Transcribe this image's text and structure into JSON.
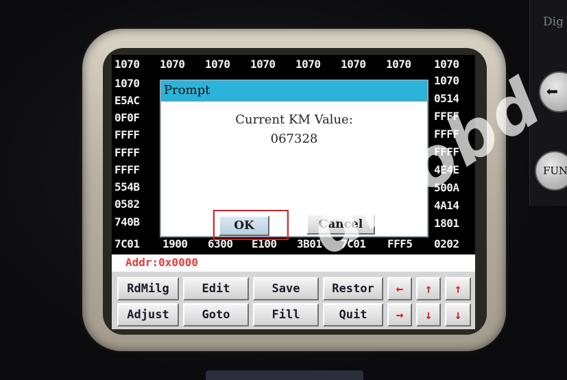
{
  "device": {
    "side_label": "Dig",
    "fun_label": "FUN"
  },
  "grid": {
    "top_row": [
      "1070",
      "1070",
      "1070",
      "1070",
      "1070",
      "1070",
      "1070",
      "1070"
    ],
    "left_col": [
      "1070",
      "E5AC",
      "0F0F",
      "FFFF",
      "FFFF",
      "FFFF",
      "554B",
      "0582",
      "740B"
    ],
    "right_col": [
      "1070",
      "0514",
      "FFFF",
      "FFFF",
      "FFFF",
      "4E4E",
      "500A",
      "4A14",
      "1801"
    ],
    "bottom_row": [
      "7C01",
      "1900",
      "6300",
      "E100",
      "3B01",
      "7C01",
      "FFF5",
      "0202"
    ]
  },
  "dialog": {
    "title": "Prompt",
    "message_line1": "Current KM Value:",
    "message_line2": "067328",
    "ok_label": "OK",
    "cancel_label": "Cancel"
  },
  "address": {
    "text": "Addr:0x0000"
  },
  "keys": {
    "row1": [
      "RdMilg",
      "Edit",
      "Save",
      "Restor",
      "←",
      "↑",
      "↑"
    ],
    "row2": [
      "Adjust",
      "Goto",
      "Fill",
      "Quit",
      "→",
      "↓",
      "↓"
    ]
  },
  "watermark": "diyobd",
  "colors": {
    "dialog_title_bar": "#2cb3d9",
    "focus_outline": "#e0181c",
    "address_text": "#e0403a",
    "arrow_keys": "#d02a2a"
  }
}
